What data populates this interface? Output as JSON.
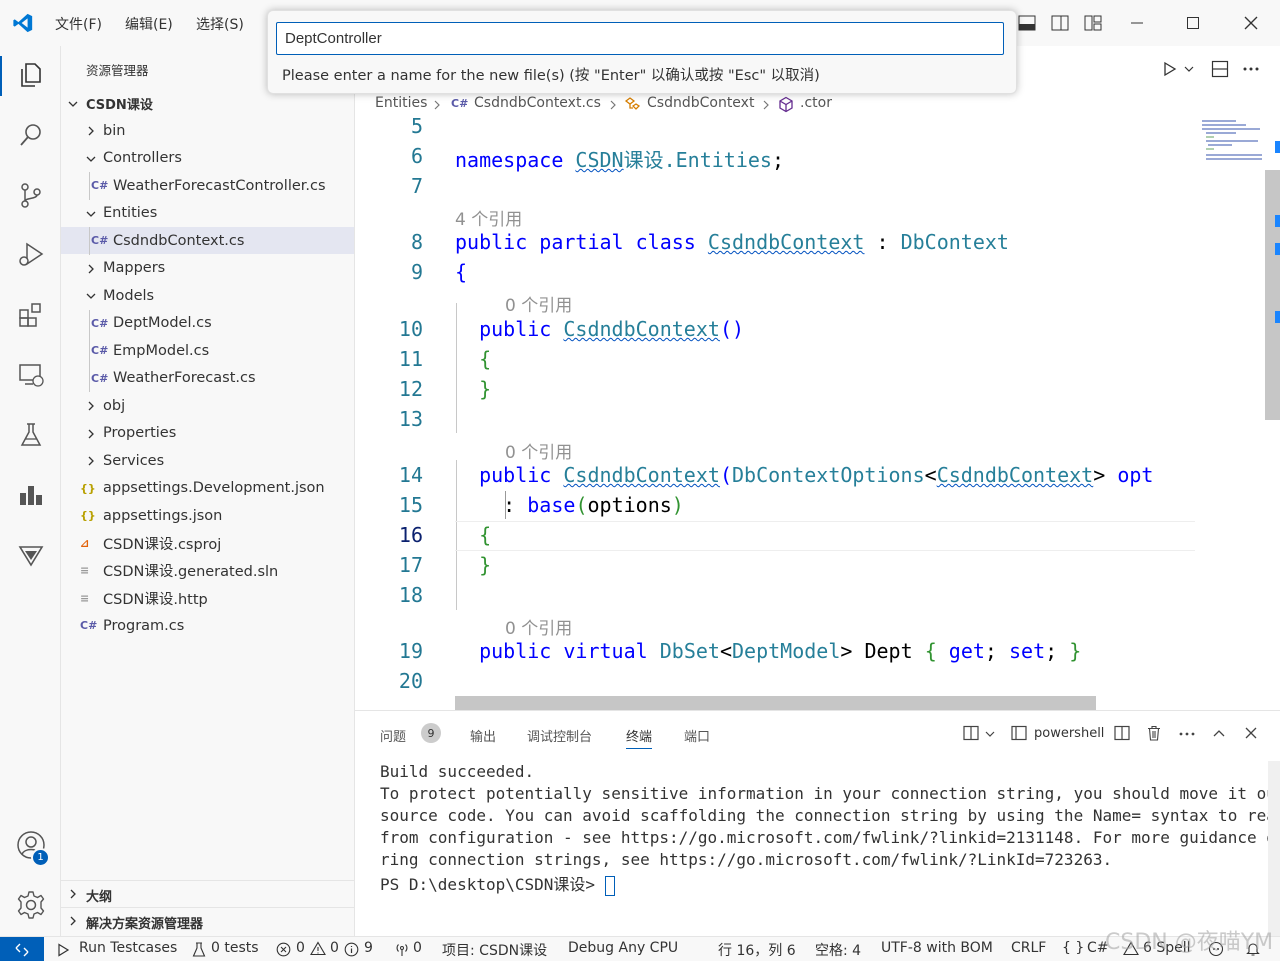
{
  "menu": {
    "file": "文件(F)",
    "edit": "编辑(E)",
    "select": "选择(S)"
  },
  "quick_input": {
    "value": "DeptController",
    "message": "Please enter a name for the new file(s) (按 \"Enter\" 以确认或按 \"Esc\" 以取消)"
  },
  "sidebar": {
    "title": "资源管理器",
    "root": "CSDN课设",
    "items": [
      {
        "label": "bin",
        "kind": "folder",
        "expanded": false,
        "level": 1
      },
      {
        "label": "Controllers",
        "kind": "folder",
        "expanded": true,
        "level": 1
      },
      {
        "label": "WeatherForecastController.cs",
        "kind": "cs",
        "level": 2
      },
      {
        "label": "Entities",
        "kind": "folder",
        "expanded": true,
        "level": 1
      },
      {
        "label": "CsdndbContext.cs",
        "kind": "cs",
        "level": 2,
        "selected": true
      },
      {
        "label": "Mappers",
        "kind": "folder",
        "expanded": false,
        "level": 1
      },
      {
        "label": "Models",
        "kind": "folder",
        "expanded": true,
        "level": 1
      },
      {
        "label": "DeptModel.cs",
        "kind": "cs",
        "level": 2
      },
      {
        "label": "EmpModel.cs",
        "kind": "cs",
        "level": 2
      },
      {
        "label": "WeatherForecast.cs",
        "kind": "cs",
        "level": 2
      },
      {
        "label": "obj",
        "kind": "folder",
        "expanded": false,
        "level": 1
      },
      {
        "label": "Properties",
        "kind": "folder",
        "expanded": false,
        "level": 1
      },
      {
        "label": "Services",
        "kind": "folder",
        "expanded": false,
        "level": 1
      },
      {
        "label": "appsettings.Development.json",
        "kind": "json",
        "level": 1
      },
      {
        "label": "appsettings.json",
        "kind": "json",
        "level": 1
      },
      {
        "label": "CSDN课设.csproj",
        "kind": "rss",
        "level": 1
      },
      {
        "label": "CSDN课设.generated.sln",
        "kind": "txt",
        "level": 1
      },
      {
        "label": "CSDN课设.http",
        "kind": "txt",
        "level": 1
      },
      {
        "label": "Program.cs",
        "kind": "cs",
        "level": 1
      }
    ],
    "outline": "大纲",
    "solution": "解决方案资源管理器"
  },
  "breadcrumb": {
    "entities": "Entities",
    "file": "CsdndbContext.cs",
    "class": "CsdndbContext",
    "member": ".ctor"
  },
  "code": {
    "ln": [
      "5",
      "6",
      "7",
      "8",
      "9",
      "10",
      "11",
      "12",
      "13",
      "14",
      "15",
      "16",
      "17",
      "18",
      "19",
      "20"
    ],
    "lens_4": "4 个引用",
    "lens_0": "0 个引用",
    "ns_kw": "namespace",
    "ns_a": "CSDN",
    "ns_b": "课设",
    "ns_c": ".Entities",
    "semi": ";",
    "public": "public",
    "partial": "partial",
    "class": "class",
    "virtual": "virtual",
    "class_name": "CsdndbContext",
    "colon": ":",
    "base_type": "DbContext",
    "open": "{",
    "close": "}",
    "ctor": "CsdndbContext",
    "parens": "()",
    "lparen": "(",
    "rparen": ")",
    "opts_type": "DbContextOptions",
    "lt": "<",
    "gt": ">",
    "opt_rest": "opt",
    "base": "base",
    "options": "options",
    "dbset": "DbSet",
    "deptmodel": "DeptModel",
    "dept": "Dept",
    "get": "get",
    "set": "set"
  },
  "panel": {
    "tabs": [
      "问题",
      "输出",
      "调试控制台",
      "终端",
      "端口"
    ],
    "problems_count": "9",
    "terminal_name": "powershell",
    "lines": [
      "Build succeeded.",
      "To protect potentially sensitive information in your connection string, you should move it out of",
      "source code. You can avoid scaffolding the connection string by using the Name= syntax to read it",
      "from configuration - see https://go.microsoft.com/fwlink/?linkid=2131148. For more guidance on sto",
      "ring connection strings, see https://go.microsoft.com/fwlink/?LinkId=723263."
    ],
    "prompt": "PS D:\\desktop\\CSDN课设> "
  },
  "status": {
    "run_testcases": "Run Testcases",
    "tests": "0 tests",
    "errors": "0",
    "warnings": "0",
    "infos": "9",
    "ports": "0",
    "project": "项目: CSDN课设",
    "config": "Debug Any CPU",
    "position": "行 16，列 6",
    "spaces": "空格: 4",
    "encoding": "UTF-8 with BOM",
    "eol": "CRLF",
    "braces": "{ }",
    "language": "C#",
    "spell": "6 Spell"
  },
  "watermark": "CSDN @夜喵YM",
  "accounts_badge": "1"
}
